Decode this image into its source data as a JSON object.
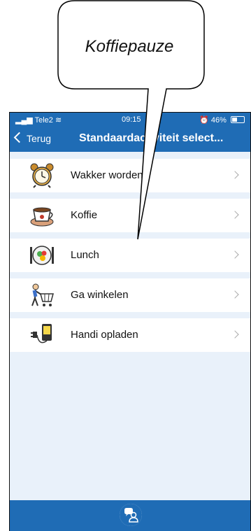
{
  "callout": {
    "text": "Koffiepauze"
  },
  "statusbar": {
    "carrier": "Tele2",
    "time": "09:15",
    "battery": "46%"
  },
  "navbar": {
    "back_label": "Terug",
    "title": "Standaardactiviteit select..."
  },
  "activities": [
    {
      "label": "Wakker worden",
      "icon": "alarm-clock-icon"
    },
    {
      "label": "Koffie",
      "icon": "coffee-cup-icon"
    },
    {
      "label": "Lunch",
      "icon": "plate-cutlery-icon"
    },
    {
      "label": "Ga winkelen",
      "icon": "shopping-cart-icon"
    },
    {
      "label": "Handi opladen",
      "icon": "phone-charger-icon"
    }
  ],
  "tabbar": {
    "icon": "person-chat-icon"
  },
  "colors": {
    "accent": "#1f6cb5",
    "background": "#e9f1fa"
  }
}
